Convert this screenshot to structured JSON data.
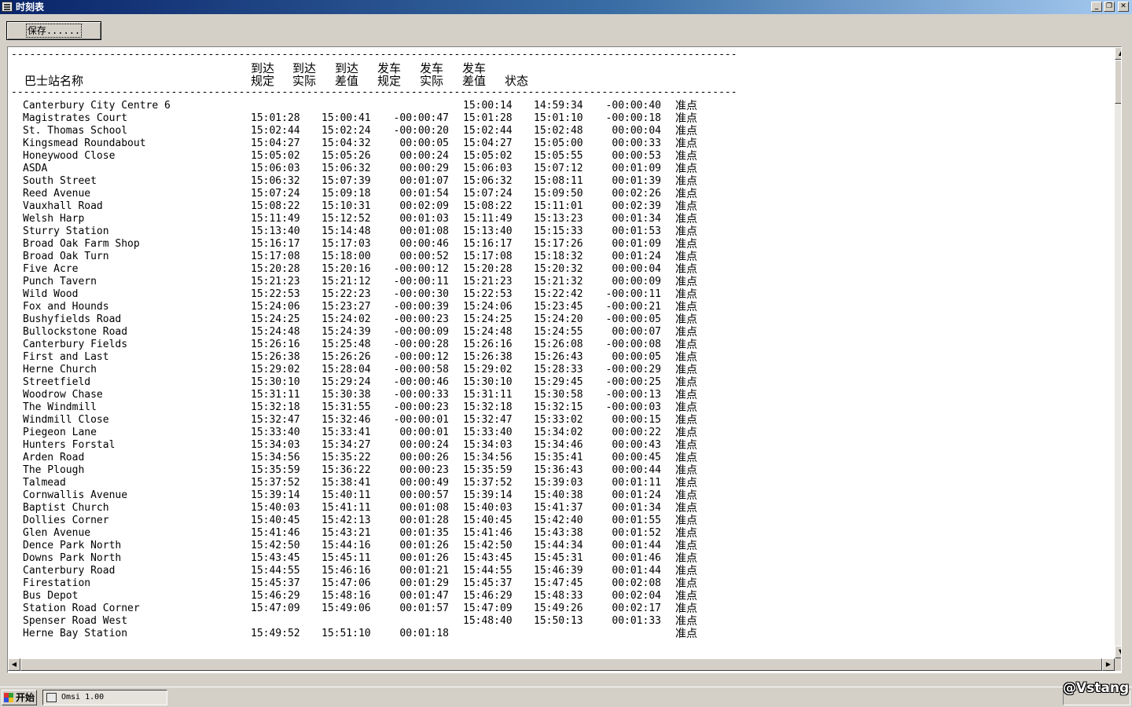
{
  "window": {
    "title": "时刻表",
    "minimize_glyph": "_",
    "maximize_glyph": "❐",
    "close_glyph": "✕"
  },
  "toolbar": {
    "save_label": "保存......"
  },
  "table": {
    "divider": "------------------------------------------------------------------------------------------------------------------------------------------------",
    "headers": {
      "name": "巴士站名称",
      "arr_sched_1": "到达",
      "arr_sched_2": "规定",
      "arr_act_1": "到达",
      "arr_act_2": "实际",
      "arr_diff_1": "到达",
      "arr_diff_2": "差值",
      "dep_sched_1": "发车",
      "dep_sched_2": "规定",
      "dep_act_1": "发车",
      "dep_act_2": "实际",
      "dep_diff_1": "发车",
      "dep_diff_2": "差值",
      "status": "状态"
    },
    "rows": [
      [
        "Canterbury City Centre 6",
        "",
        "",
        "",
        "15:00:14",
        "14:59:34",
        "-00:00:40",
        "准点"
      ],
      [
        "Magistrates Court",
        "15:01:28",
        "15:00:41",
        "-00:00:47",
        "15:01:28",
        "15:01:10",
        "-00:00:18",
        "准点"
      ],
      [
        "St. Thomas School",
        "15:02:44",
        "15:02:24",
        "-00:00:20",
        "15:02:44",
        "15:02:48",
        "00:00:04",
        "准点"
      ],
      [
        "Kingsmead Roundabout",
        "15:04:27",
        "15:04:32",
        "00:00:05",
        "15:04:27",
        "15:05:00",
        "00:00:33",
        "准点"
      ],
      [
        "Honeywood Close",
        "15:05:02",
        "15:05:26",
        "00:00:24",
        "15:05:02",
        "15:05:55",
        "00:00:53",
        "准点"
      ],
      [
        "ASDA",
        "15:06:03",
        "15:06:32",
        "00:00:29",
        "15:06:03",
        "15:07:12",
        "00:01:09",
        "准点"
      ],
      [
        "South Street",
        "15:06:32",
        "15:07:39",
        "00:01:07",
        "15:06:32",
        "15:08:11",
        "00:01:39",
        "准点"
      ],
      [
        "Reed Avenue",
        "15:07:24",
        "15:09:18",
        "00:01:54",
        "15:07:24",
        "15:09:50",
        "00:02:26",
        "准点"
      ],
      [
        "Vauxhall Road",
        "15:08:22",
        "15:10:31",
        "00:02:09",
        "15:08:22",
        "15:11:01",
        "00:02:39",
        "准点"
      ],
      [
        "Welsh Harp",
        "15:11:49",
        "15:12:52",
        "00:01:03",
        "15:11:49",
        "15:13:23",
        "00:01:34",
        "准点"
      ],
      [
        "Sturry Station",
        "15:13:40",
        "15:14:48",
        "00:01:08",
        "15:13:40",
        "15:15:33",
        "00:01:53",
        "准点"
      ],
      [
        "Broad Oak Farm Shop",
        "15:16:17",
        "15:17:03",
        "00:00:46",
        "15:16:17",
        "15:17:26",
        "00:01:09",
        "准点"
      ],
      [
        "Broad Oak Turn",
        "15:17:08",
        "15:18:00",
        "00:00:52",
        "15:17:08",
        "15:18:32",
        "00:01:24",
        "准点"
      ],
      [
        "Five Acre",
        "15:20:28",
        "15:20:16",
        "-00:00:12",
        "15:20:28",
        "15:20:32",
        "00:00:04",
        "准点"
      ],
      [
        "Punch Tavern",
        "15:21:23",
        "15:21:12",
        "-00:00:11",
        "15:21:23",
        "15:21:32",
        "00:00:09",
        "准点"
      ],
      [
        "Wild Wood",
        "15:22:53",
        "15:22:23",
        "-00:00:30",
        "15:22:53",
        "15:22:42",
        "-00:00:11",
        "准点"
      ],
      [
        "Fox and Hounds",
        "15:24:06",
        "15:23:27",
        "-00:00:39",
        "15:24:06",
        "15:23:45",
        "-00:00:21",
        "准点"
      ],
      [
        "Bushyfields Road",
        "15:24:25",
        "15:24:02",
        "-00:00:23",
        "15:24:25",
        "15:24:20",
        "-00:00:05",
        "准点"
      ],
      [
        "Bullockstone Road",
        "15:24:48",
        "15:24:39",
        "-00:00:09",
        "15:24:48",
        "15:24:55",
        "00:00:07",
        "准点"
      ],
      [
        "Canterbury Fields",
        "15:26:16",
        "15:25:48",
        "-00:00:28",
        "15:26:16",
        "15:26:08",
        "-00:00:08",
        "准点"
      ],
      [
        "First and Last",
        "15:26:38",
        "15:26:26",
        "-00:00:12",
        "15:26:38",
        "15:26:43",
        "00:00:05",
        "准点"
      ],
      [
        "Herne Church",
        "15:29:02",
        "15:28:04",
        "-00:00:58",
        "15:29:02",
        "15:28:33",
        "-00:00:29",
        "准点"
      ],
      [
        "Streetfield",
        "15:30:10",
        "15:29:24",
        "-00:00:46",
        "15:30:10",
        "15:29:45",
        "-00:00:25",
        "准点"
      ],
      [
        "Woodrow Chase",
        "15:31:11",
        "15:30:38",
        "-00:00:33",
        "15:31:11",
        "15:30:58",
        "-00:00:13",
        "准点"
      ],
      [
        "The Windmill",
        "15:32:18",
        "15:31:55",
        "-00:00:23",
        "15:32:18",
        "15:32:15",
        "-00:00:03",
        "准点"
      ],
      [
        "Windmill Close",
        "15:32:47",
        "15:32:46",
        "-00:00:01",
        "15:32:47",
        "15:33:02",
        "00:00:15",
        "准点"
      ],
      [
        "Piegeon Lane",
        "15:33:40",
        "15:33:41",
        "00:00:01",
        "15:33:40",
        "15:34:02",
        "00:00:22",
        "准点"
      ],
      [
        "Hunters Forstal",
        "15:34:03",
        "15:34:27",
        "00:00:24",
        "15:34:03",
        "15:34:46",
        "00:00:43",
        "准点"
      ],
      [
        "Arden Road",
        "15:34:56",
        "15:35:22",
        "00:00:26",
        "15:34:56",
        "15:35:41",
        "00:00:45",
        "准点"
      ],
      [
        "The Plough",
        "15:35:59",
        "15:36:22",
        "00:00:23",
        "15:35:59",
        "15:36:43",
        "00:00:44",
        "准点"
      ],
      [
        "Talmead",
        "15:37:52",
        "15:38:41",
        "00:00:49",
        "15:37:52",
        "15:39:03",
        "00:01:11",
        "准点"
      ],
      [
        "Cornwallis Avenue",
        "15:39:14",
        "15:40:11",
        "00:00:57",
        "15:39:14",
        "15:40:38",
        "00:01:24",
        "准点"
      ],
      [
        "Baptist Church",
        "15:40:03",
        "15:41:11",
        "00:01:08",
        "15:40:03",
        "15:41:37",
        "00:01:34",
        "准点"
      ],
      [
        "Dollies Corner",
        "15:40:45",
        "15:42:13",
        "00:01:28",
        "15:40:45",
        "15:42:40",
        "00:01:55",
        "准点"
      ],
      [
        "Glen Avenue",
        "15:41:46",
        "15:43:21",
        "00:01:35",
        "15:41:46",
        "15:43:38",
        "00:01:52",
        "准点"
      ],
      [
        "Dence Park North",
        "15:42:50",
        "15:44:16",
        "00:01:26",
        "15:42:50",
        "15:44:34",
        "00:01:44",
        "准点"
      ],
      [
        "Downs Park North",
        "15:43:45",
        "15:45:11",
        "00:01:26",
        "15:43:45",
        "15:45:31",
        "00:01:46",
        "准点"
      ],
      [
        "Canterbury Road",
        "15:44:55",
        "15:46:16",
        "00:01:21",
        "15:44:55",
        "15:46:39",
        "00:01:44",
        "准点"
      ],
      [
        "Firestation",
        "15:45:37",
        "15:47:06",
        "00:01:29",
        "15:45:37",
        "15:47:45",
        "00:02:08",
        "准点"
      ],
      [
        "Bus Depot",
        "15:46:29",
        "15:48:16",
        "00:01:47",
        "15:46:29",
        "15:48:33",
        "00:02:04",
        "准点"
      ],
      [
        "Station Road Corner",
        "15:47:09",
        "15:49:06",
        "00:01:57",
        "15:47:09",
        "15:49:26",
        "00:02:17",
        "准点"
      ],
      [
        "Spenser Road West",
        "",
        "",
        "",
        "15:48:40",
        "15:50:13",
        "00:01:33",
        "准点"
      ],
      [
        "Herne Bay Station",
        "15:49:52",
        "15:51:10",
        "00:01:18",
        "",
        "",
        "",
        "准点"
      ]
    ]
  },
  "taskbar": {
    "start_label": "开始",
    "task_label": "Omsi 1.00"
  },
  "watermark": "@Vstang"
}
